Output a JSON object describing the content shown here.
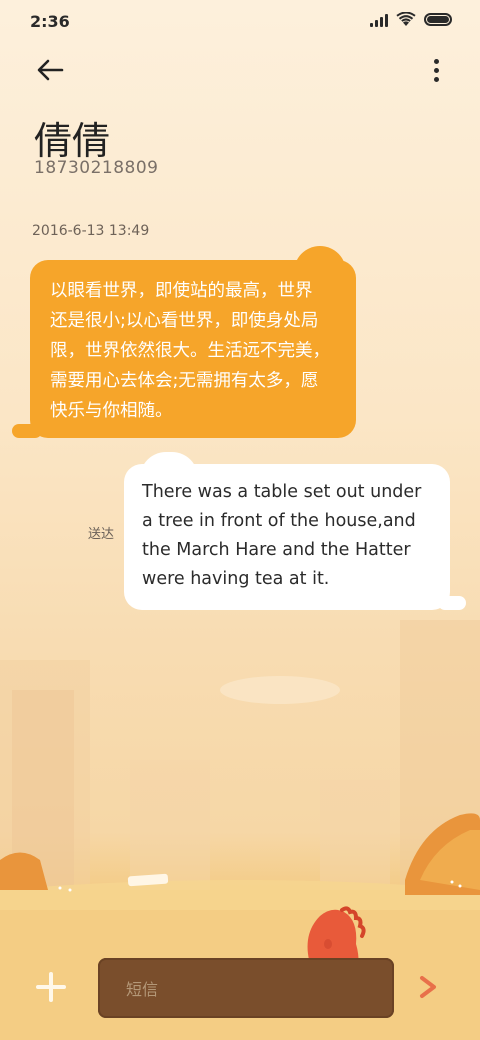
{
  "status_bar": {
    "time": "2:36",
    "battery_level": 1.0
  },
  "header": {
    "contact_name": "倩倩",
    "contact_number": "18730218809",
    "back_icon": "arrow-left-icon",
    "menu_icon": "more-vertical-icon"
  },
  "messages": [
    {
      "timestamp": "2016-6-13 13:49",
      "direction": "incoming",
      "lines": [
        "以眼看世界，即使站的最高，世界",
        "还是很小;以心看世界，即使身处局",
        "限，世界依然很大。生活远不完美，",
        "需要用心去体会;无需拥有太多，愿",
        "快乐与你相随。"
      ]
    },
    {
      "direction": "outgoing",
      "status": "送达",
      "lines": [
        "There was a table set out under",
        "a tree in front of the house,and",
        "the March Hare and the Hatter",
        "were having tea at it."
      ]
    }
  ],
  "composer": {
    "placeholder": "短信",
    "value": "",
    "add_icon": "plus-icon",
    "send_icon": "send-chevron-icon"
  },
  "colors": {
    "incoming_bubble": "#f6a52a",
    "outgoing_bubble": "#ffffff",
    "send_accent": "#e8704a"
  }
}
